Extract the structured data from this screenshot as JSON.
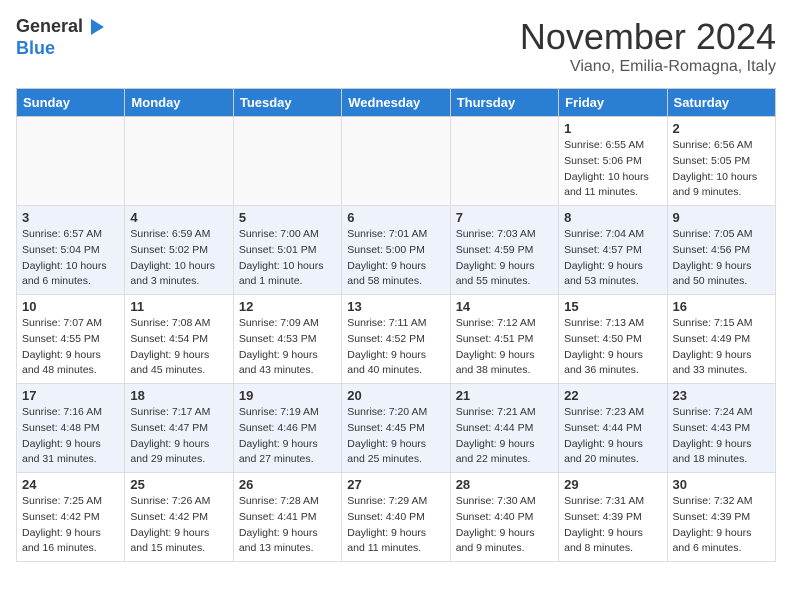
{
  "header": {
    "logo_line1": "General",
    "logo_line2": "Blue",
    "month": "November 2024",
    "location": "Viano, Emilia-Romagna, Italy"
  },
  "days_of_week": [
    "Sunday",
    "Monday",
    "Tuesday",
    "Wednesday",
    "Thursday",
    "Friday",
    "Saturday"
  ],
  "weeks": [
    [
      {
        "day": "",
        "info": ""
      },
      {
        "day": "",
        "info": ""
      },
      {
        "day": "",
        "info": ""
      },
      {
        "day": "",
        "info": ""
      },
      {
        "day": "",
        "info": ""
      },
      {
        "day": "1",
        "info": "Sunrise: 6:55 AM\nSunset: 5:06 PM\nDaylight: 10 hours\nand 11 minutes."
      },
      {
        "day": "2",
        "info": "Sunrise: 6:56 AM\nSunset: 5:05 PM\nDaylight: 10 hours\nand 9 minutes."
      }
    ],
    [
      {
        "day": "3",
        "info": "Sunrise: 6:57 AM\nSunset: 5:04 PM\nDaylight: 10 hours\nand 6 minutes."
      },
      {
        "day": "4",
        "info": "Sunrise: 6:59 AM\nSunset: 5:02 PM\nDaylight: 10 hours\nand 3 minutes."
      },
      {
        "day": "5",
        "info": "Sunrise: 7:00 AM\nSunset: 5:01 PM\nDaylight: 10 hours\nand 1 minute."
      },
      {
        "day": "6",
        "info": "Sunrise: 7:01 AM\nSunset: 5:00 PM\nDaylight: 9 hours\nand 58 minutes."
      },
      {
        "day": "7",
        "info": "Sunrise: 7:03 AM\nSunset: 4:59 PM\nDaylight: 9 hours\nand 55 minutes."
      },
      {
        "day": "8",
        "info": "Sunrise: 7:04 AM\nSunset: 4:57 PM\nDaylight: 9 hours\nand 53 minutes."
      },
      {
        "day": "9",
        "info": "Sunrise: 7:05 AM\nSunset: 4:56 PM\nDaylight: 9 hours\nand 50 minutes."
      }
    ],
    [
      {
        "day": "10",
        "info": "Sunrise: 7:07 AM\nSunset: 4:55 PM\nDaylight: 9 hours\nand 48 minutes."
      },
      {
        "day": "11",
        "info": "Sunrise: 7:08 AM\nSunset: 4:54 PM\nDaylight: 9 hours\nand 45 minutes."
      },
      {
        "day": "12",
        "info": "Sunrise: 7:09 AM\nSunset: 4:53 PM\nDaylight: 9 hours\nand 43 minutes."
      },
      {
        "day": "13",
        "info": "Sunrise: 7:11 AM\nSunset: 4:52 PM\nDaylight: 9 hours\nand 40 minutes."
      },
      {
        "day": "14",
        "info": "Sunrise: 7:12 AM\nSunset: 4:51 PM\nDaylight: 9 hours\nand 38 minutes."
      },
      {
        "day": "15",
        "info": "Sunrise: 7:13 AM\nSunset: 4:50 PM\nDaylight: 9 hours\nand 36 minutes."
      },
      {
        "day": "16",
        "info": "Sunrise: 7:15 AM\nSunset: 4:49 PM\nDaylight: 9 hours\nand 33 minutes."
      }
    ],
    [
      {
        "day": "17",
        "info": "Sunrise: 7:16 AM\nSunset: 4:48 PM\nDaylight: 9 hours\nand 31 minutes."
      },
      {
        "day": "18",
        "info": "Sunrise: 7:17 AM\nSunset: 4:47 PM\nDaylight: 9 hours\nand 29 minutes."
      },
      {
        "day": "19",
        "info": "Sunrise: 7:19 AM\nSunset: 4:46 PM\nDaylight: 9 hours\nand 27 minutes."
      },
      {
        "day": "20",
        "info": "Sunrise: 7:20 AM\nSunset: 4:45 PM\nDaylight: 9 hours\nand 25 minutes."
      },
      {
        "day": "21",
        "info": "Sunrise: 7:21 AM\nSunset: 4:44 PM\nDaylight: 9 hours\nand 22 minutes."
      },
      {
        "day": "22",
        "info": "Sunrise: 7:23 AM\nSunset: 4:44 PM\nDaylight: 9 hours\nand 20 minutes."
      },
      {
        "day": "23",
        "info": "Sunrise: 7:24 AM\nSunset: 4:43 PM\nDaylight: 9 hours\nand 18 minutes."
      }
    ],
    [
      {
        "day": "24",
        "info": "Sunrise: 7:25 AM\nSunset: 4:42 PM\nDaylight: 9 hours\nand 16 minutes."
      },
      {
        "day": "25",
        "info": "Sunrise: 7:26 AM\nSunset: 4:42 PM\nDaylight: 9 hours\nand 15 minutes."
      },
      {
        "day": "26",
        "info": "Sunrise: 7:28 AM\nSunset: 4:41 PM\nDaylight: 9 hours\nand 13 minutes."
      },
      {
        "day": "27",
        "info": "Sunrise: 7:29 AM\nSunset: 4:40 PM\nDaylight: 9 hours\nand 11 minutes."
      },
      {
        "day": "28",
        "info": "Sunrise: 7:30 AM\nSunset: 4:40 PM\nDaylight: 9 hours\nand 9 minutes."
      },
      {
        "day": "29",
        "info": "Sunrise: 7:31 AM\nSunset: 4:39 PM\nDaylight: 9 hours\nand 8 minutes."
      },
      {
        "day": "30",
        "info": "Sunrise: 7:32 AM\nSunset: 4:39 PM\nDaylight: 9 hours\nand 6 minutes."
      }
    ]
  ]
}
